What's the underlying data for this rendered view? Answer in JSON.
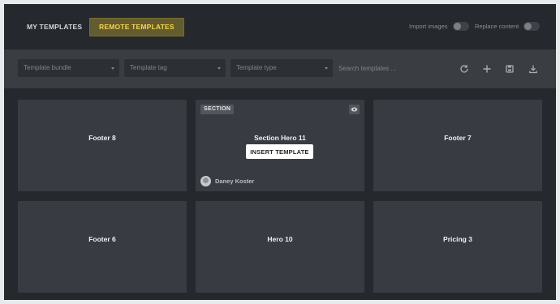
{
  "tabs": [
    {
      "label": "MY TEMPLATES",
      "active": false
    },
    {
      "label": "REMOTE TEMPLATES",
      "active": true
    }
  ],
  "options": {
    "import_images": {
      "label": "Import images",
      "on": false
    },
    "replace_content": {
      "label": "Replace content",
      "on": false
    }
  },
  "filters": {
    "bundle": "Template bundle",
    "tag": "Template tag",
    "type": "Template type"
  },
  "search": {
    "placeholder": "Search templates ..."
  },
  "toolbar": {
    "icons": [
      "refresh-icon",
      "plus-icon",
      "save-icon",
      "download-icon"
    ]
  },
  "templates": [
    {
      "title": "Footer 8"
    },
    {
      "title": "Section Hero 11",
      "badge": "SECTION",
      "action": "INSERT TEMPLATE",
      "author": "Daney Koster"
    },
    {
      "title": "Footer 7"
    },
    {
      "title": "Footer 6"
    },
    {
      "title": "Hero 10"
    },
    {
      "title": "Pricing 3"
    }
  ],
  "colors": {
    "accent_bg": "#635c2f",
    "accent_text": "#f5d44c",
    "card_bg": "#383c42",
    "panel_bg": "#25282c"
  }
}
